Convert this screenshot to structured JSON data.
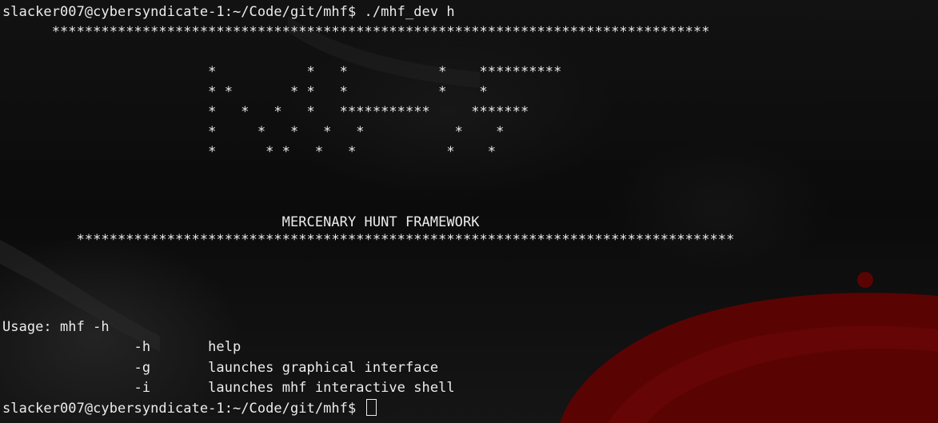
{
  "terminal": {
    "prompt": "slacker007@cybersyndicate-1:~/Code/git/mhf$",
    "command": " ./mhf_dev h",
    "banner_top": "      ********************************************************************************",
    "logo_lines": [
      "",
      "                         *           *   *           *    **********",
      "                         * *       * *   *           *    *",
      "                         *   *   *   *   ***********     *******",
      "                         *     *   *   *   *           *    *",
      "                         *      * *   *   *           *    *"
    ],
    "title": "                                  MERCENARY HUNT FRAMEWORK",
    "banner_bottom": "         ********************************************************************************",
    "usage": "Usage: mhf -h",
    "options": [
      {
        "flag": "                -h",
        "desc": "       help"
      },
      {
        "flag": "                -g",
        "desc": "       launches graphical interface"
      },
      {
        "flag": "                -i",
        "desc": "       launches mhf interactive shell"
      }
    ],
    "final_prompt": "slacker007@cybersyndicate-1:~/Code/git/mhf$ "
  },
  "colors": {
    "text": "#ececec",
    "background": "#0b0b0b",
    "accent": "#5a0303"
  }
}
